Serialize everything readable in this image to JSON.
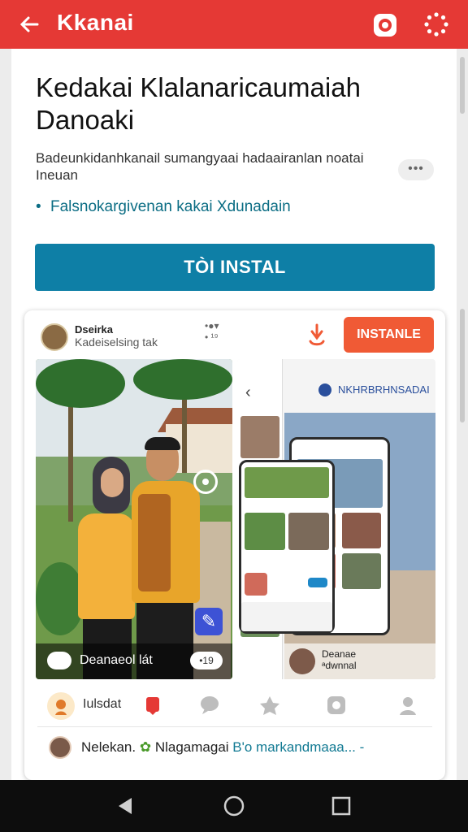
{
  "appbar": {
    "back_icon": "arrow-left-icon",
    "title": "Kkanai",
    "record_icon": "record-icon",
    "loading_icon": "loading-spinner-icon",
    "color": "#e53935"
  },
  "article": {
    "headline": "Kedakai Klalanaricaumaiah Danoaki",
    "subtext": "Badeunkidanhkanail sumangyaai hadaairanlan noatai Ineuan",
    "more_label": "•••",
    "bullet": "Falsnokargivenan kakai Xdunadain",
    "install_button": "TÒI INSTAL",
    "button_color": "#0e7fa6"
  },
  "ad": {
    "advertiser": "Dseirka",
    "subtitle": "Kadeiselsing   tak",
    "corner_text": "•● ● ▾\n• ᵈ¹⁹",
    "install_button": "INSTANLE",
    "install_color": "#f05a35",
    "left_caption": "Deanaeol lát",
    "left_pill": "•19",
    "right_label": "NKHRBRHNSADAI",
    "right_caption": "Deanae\nᵃdwnnal",
    "reaction_label": "Iulsdat",
    "comment_name": "Nelekan.",
    "comment_middle": "Nlagamagai",
    "comment_link": "B'o markandmaaa... -"
  },
  "navbar": {
    "back_icon": "nav-back-icon",
    "home_icon": "nav-home-icon",
    "recents_icon": "nav-recents-icon"
  }
}
